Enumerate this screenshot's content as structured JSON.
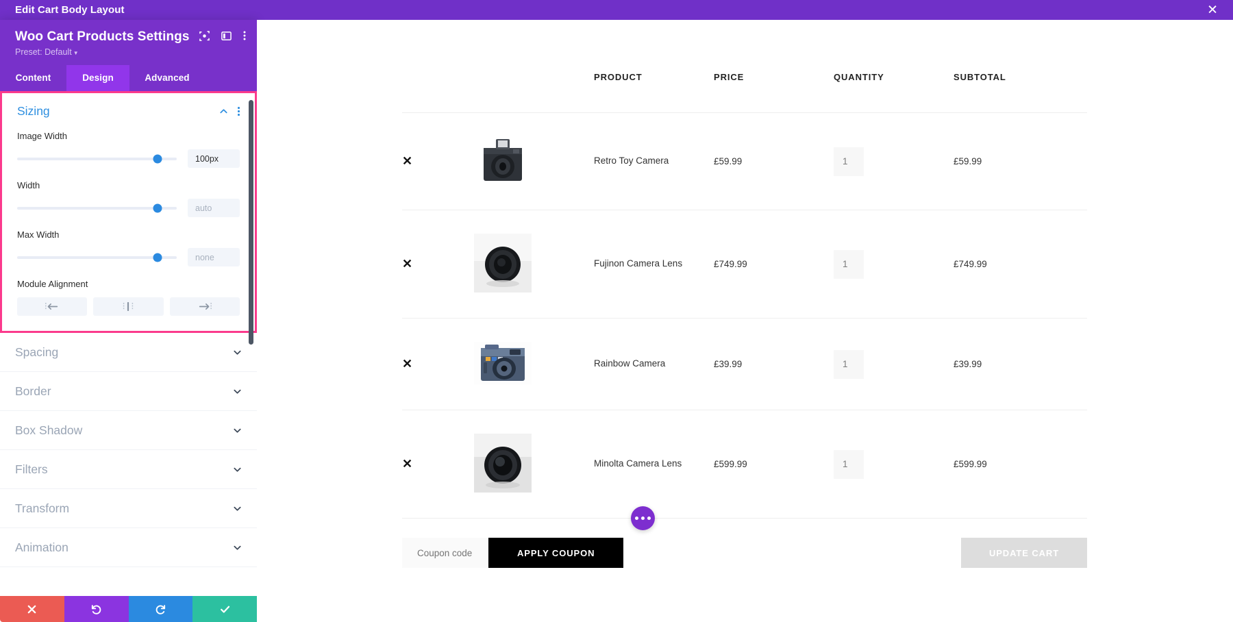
{
  "topbar": {
    "title": "Edit Cart Body Layout",
    "close_icon": "close-icon"
  },
  "panel": {
    "title": "Woo Cart Products Settings",
    "preset_label": "Preset: Default",
    "header_icons": [
      "focus-target-icon",
      "layout-panel-icon",
      "vertical-dots-icon"
    ],
    "tabs": [
      {
        "label": "Content",
        "active": false
      },
      {
        "label": "Design",
        "active": true
      },
      {
        "label": "Advanced",
        "active": false
      }
    ],
    "sizing": {
      "title": "Sizing",
      "collapse_icon": "chevron-up-icon",
      "options_icon": "vertical-dots-icon",
      "fields": [
        {
          "label": "Image Width",
          "value": "100px",
          "is_placeholder": false,
          "knob_percent": 88
        },
        {
          "label": "Width",
          "value": "auto",
          "is_placeholder": true,
          "knob_percent": 88
        },
        {
          "label": "Max Width",
          "value": "none",
          "is_placeholder": true,
          "knob_percent": 88
        }
      ],
      "alignment": {
        "label": "Module Alignment",
        "buttons": [
          "align-left-icon",
          "align-center-icon",
          "align-right-icon"
        ]
      }
    },
    "collapsed_groups": [
      {
        "label": "Spacing",
        "icon": "chevron-down-icon"
      },
      {
        "label": "Border",
        "icon": "chevron-down-icon"
      },
      {
        "label": "Box Shadow",
        "icon": "chevron-down-icon"
      },
      {
        "label": "Filters",
        "icon": "chevron-down-icon"
      },
      {
        "label": "Transform",
        "icon": "chevron-down-icon"
      },
      {
        "label": "Animation",
        "icon": "chevron-down-icon"
      }
    ],
    "actions": [
      {
        "name": "cancel-button",
        "icon": "close-icon",
        "color": "#eb5b53"
      },
      {
        "name": "undo-button",
        "icon": "undo-icon",
        "color": "#8b34e0"
      },
      {
        "name": "redo-button",
        "icon": "redo-icon",
        "color": "#2b8ae0"
      },
      {
        "name": "save-button",
        "icon": "check-icon",
        "color": "#2cc0a0"
      }
    ]
  },
  "cart": {
    "columns": [
      "",
      "",
      "PRODUCT",
      "PRICE",
      "QUANTITY",
      "SUBTOTAL"
    ],
    "remove_glyph": "✕",
    "rows": [
      {
        "name": "Retro Toy Camera",
        "price": "£59.99",
        "quantity": "1",
        "subtotal": "£59.99",
        "thumb": "retro-toy-camera-thumbnail"
      },
      {
        "name": "Fujinon Camera Lens",
        "price": "£749.99",
        "quantity": "1",
        "subtotal": "£749.99",
        "thumb": "fujinon-camera-lens-thumbnail"
      },
      {
        "name": "Rainbow Camera",
        "price": "£39.99",
        "quantity": "1",
        "subtotal": "£39.99",
        "thumb": "rainbow-camera-thumbnail"
      },
      {
        "name": "Minolta Camera Lens",
        "price": "£599.99",
        "quantity": "1",
        "subtotal": "£599.99",
        "thumb": "minolta-camera-lens-thumbnail"
      }
    ],
    "coupon_placeholder": "Coupon code",
    "apply_coupon_label": "APPLY COUPON",
    "update_cart_label": "UPDATE CART"
  },
  "fab": {
    "icon": "ellipsis-icon"
  },
  "colors": {
    "topbar": "#7030c8",
    "panel_header": "#7831ca",
    "active_tab": "#9136ea",
    "highlight_border": "#fb3a8c",
    "accent_blue": "#2b8ae0",
    "apply_button": "#000000",
    "update_button": "#dddddd",
    "fab": "#7d2ecf"
  }
}
